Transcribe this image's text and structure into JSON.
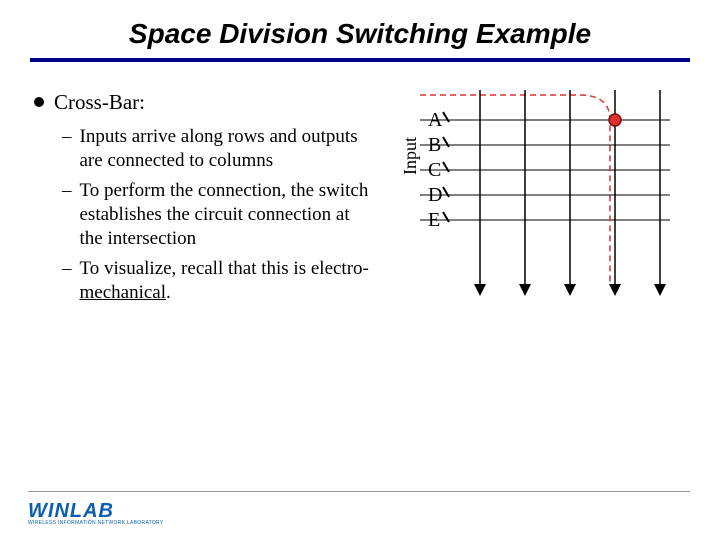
{
  "title": "Space Division Switching Example",
  "bullet": "Cross-Bar:",
  "subbullets": [
    "Inputs arrive along rows and outputs are connected to columns",
    "To perform the connection, the switch establishes the circuit connection at the intersection",
    "To visualize, recall that this is electro-"
  ],
  "sub3_underlined": "mechanical",
  "sub3_suffix": ".",
  "axis_label": "Input",
  "row_labels": [
    "A",
    "B",
    "C",
    "D",
    "E"
  ],
  "footer_logo_first": "W",
  "footer_logo_rest": "INLAB",
  "footer_sub": "WIRELESS INFORMATION NETWORK LABORATORY"
}
